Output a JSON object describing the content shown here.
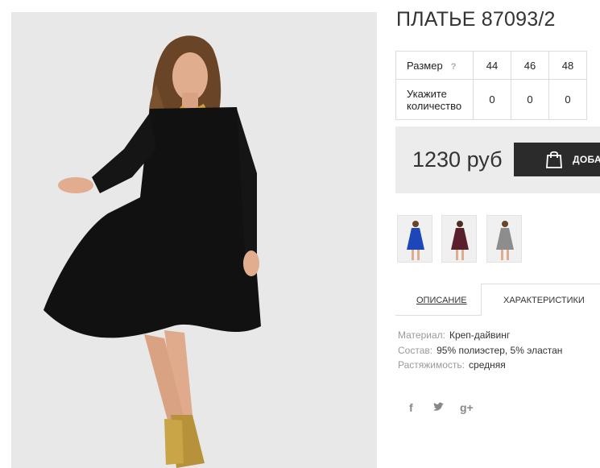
{
  "product": {
    "title": "ПЛАТЬЕ 87093/2"
  },
  "sizes": {
    "size_label": "Размер",
    "help_icon": "?",
    "values": [
      "44",
      "46",
      "48"
    ],
    "quantity_label": "Укажите количество",
    "quantities": [
      "0",
      "0",
      "0"
    ]
  },
  "purchase": {
    "price": "1230 руб",
    "cart_label": "ДОБАВИТЬ",
    "accent": "#2b2b2b"
  },
  "thumbnails": [
    {
      "name": "blue-dress",
      "color": "#1d47b8"
    },
    {
      "name": "burgundy-dress",
      "color": "#5a1f2c"
    },
    {
      "name": "grey-dress",
      "color": "#8d8d8d"
    }
  ],
  "tabs": [
    {
      "label": "Описание",
      "active": false
    },
    {
      "label": "Характеристики",
      "active": true
    }
  ],
  "specs": [
    {
      "key": "Материал:",
      "value": "Креп-дайвинг"
    },
    {
      "key": "Состав:",
      "value": "95% полиэстер, 5% эластан"
    },
    {
      "key": "Растяжимость:",
      "value": "средняя"
    }
  ],
  "social": [
    {
      "name": "facebook-icon",
      "glyph": "f"
    },
    {
      "name": "twitter-icon",
      "glyph": "t"
    },
    {
      "name": "google-plus-icon",
      "glyph": "g+"
    }
  ]
}
